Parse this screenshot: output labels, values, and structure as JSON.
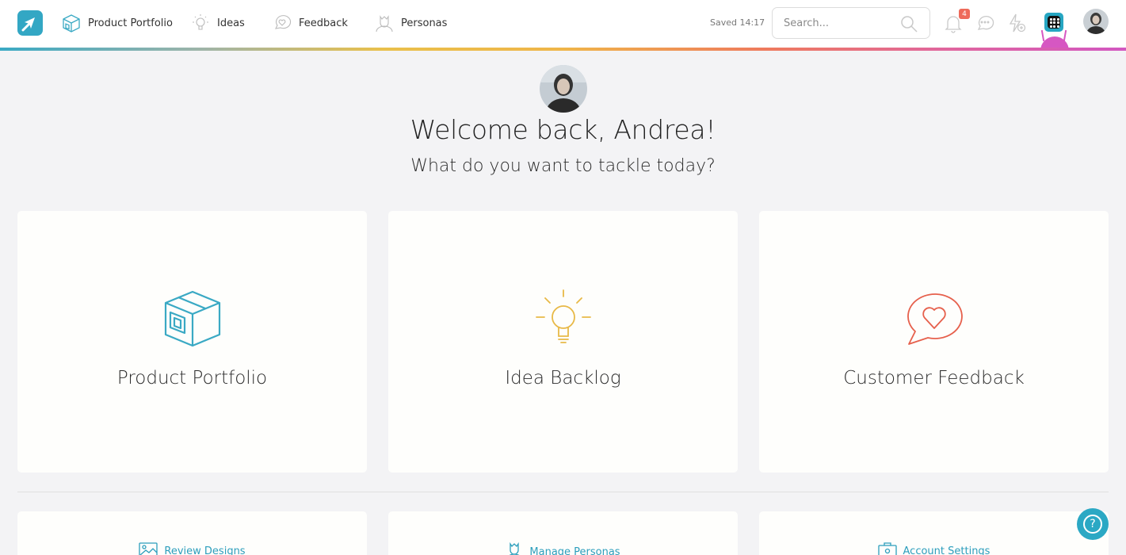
{
  "nav": {
    "items": [
      {
        "label": "Product Portfolio",
        "icon": "box-icon"
      },
      {
        "label": "Ideas",
        "icon": "lightbulb-icon"
      },
      {
        "label": "Feedback",
        "icon": "heart-bubble-icon"
      },
      {
        "label": "Personas",
        "icon": "persona-icon"
      }
    ]
  },
  "header": {
    "saved_text": "Saved 14:17",
    "search_placeholder": "Search...",
    "notification_count": "4"
  },
  "hero": {
    "welcome": "Welcome back, Andrea!",
    "subtitle": "What do you want to tackle today?"
  },
  "cards": [
    {
      "title": "Product Portfolio",
      "icon": "box-icon",
      "color": "#3aa9c4"
    },
    {
      "title": "Idea Backlog",
      "icon": "lightbulb-icon",
      "color": "#e8b947"
    },
    {
      "title": "Customer Feedback",
      "icon": "heart-bubble-icon",
      "color": "#e6604c"
    }
  ],
  "secondary": [
    {
      "label": "Review Designs",
      "icon": "image-icon"
    },
    {
      "label": "Manage Personas",
      "icon": "persona-icon"
    },
    {
      "label": "Account Settings",
      "icon": "briefcase-icon"
    }
  ],
  "help": {
    "label": "?"
  },
  "colors": {
    "accent": "#33a7c4",
    "badge": "#ee6a5a",
    "background": "#f3f3f5"
  }
}
